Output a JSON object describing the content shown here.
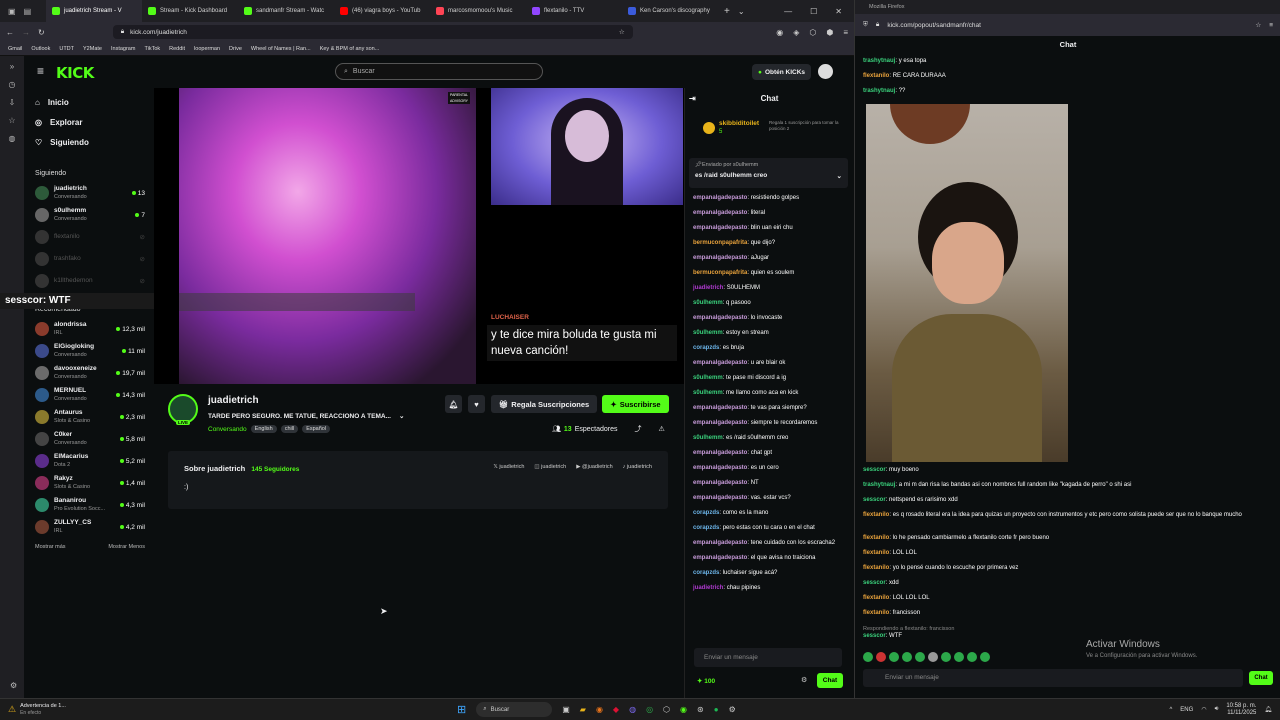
{
  "browser": {
    "tabs": [
      {
        "label": "juadietrich Stream - V",
        "color": "#53fc18",
        "active": true
      },
      {
        "label": "Stream - Kick Dashboard",
        "color": "#53fc18"
      },
      {
        "label": "sandmanfr Stream - Watc",
        "color": "#53fc18"
      },
      {
        "label": "(46) viagra boys - YouTub",
        "color": "#ff0000"
      },
      {
        "label": "marcosmomoou's Music",
        "color": "#ff4455"
      },
      {
        "label": "flextanilo - TTV",
        "color": "#9146ff"
      },
      {
        "label": "Ken Carson's discography",
        "color": "#3b5bdb"
      }
    ],
    "url": "kick.com/juadietrich",
    "bookmarks": [
      "Gmail",
      "Outlook",
      "UTDT",
      "Y2Mate",
      "Instagram",
      "TikTok",
      "Reddit",
      "looperman",
      "Drive",
      "Wheel of Names | Ran...",
      "Key & BPM of any son..."
    ]
  },
  "kick": {
    "search_placeholder": "Buscar",
    "kicks_label": "Obtén KICKs",
    "nav": [
      {
        "label": "Inicio",
        "icon": "home-icon"
      },
      {
        "label": "Explorar",
        "icon": "compass-icon"
      },
      {
        "label": "Siguiendo",
        "icon": "heart-icon"
      }
    ],
    "following_header": "Siguiendo",
    "following": [
      {
        "name": "juadietrich",
        "sub": "Conversando",
        "count": "13",
        "online": true
      },
      {
        "name": "s0ulhemm",
        "sub": "Conversando",
        "count": "7",
        "online": true
      },
      {
        "name": "flextanilo",
        "sub": "",
        "count": "",
        "online": false
      },
      {
        "name": "trashfako",
        "sub": "",
        "count": "",
        "online": false
      },
      {
        "name": "k1llthedemon",
        "sub": "",
        "count": "",
        "online": false
      }
    ],
    "overlay_user": "sesscor",
    "overlay_text": ": WTF",
    "recommended_header": "Recomendado",
    "recommended": [
      {
        "name": "alondrissa",
        "sub": "IRL",
        "count": "12,3 mil"
      },
      {
        "name": "ElGiogloking",
        "sub": "Conversando",
        "count": "11 mil"
      },
      {
        "name": "davooxeneize",
        "sub": "Conversando",
        "count": "19,7 mil"
      },
      {
        "name": "MERNUEL",
        "sub": "Conversando",
        "count": "14,3 mil"
      },
      {
        "name": "Antaurus",
        "sub": "Slots & Casino",
        "count": "2,3 mil"
      },
      {
        "name": "C0ker",
        "sub": "Conversando",
        "count": "5,8 mil"
      },
      {
        "name": "ElMacarius",
        "sub": "Dota 2",
        "count": "5,2 mil"
      },
      {
        "name": "Rakyz",
        "sub": "Slots & Casino",
        "count": "1,4 mil"
      },
      {
        "name": "Bananirou",
        "sub": "Pro Evolution Socc...",
        "count": "4,3 mil"
      },
      {
        "name": "ZULLYY_CS",
        "sub": "IRL",
        "count": "4,2 mil"
      }
    ],
    "show_more": "Mostrar más",
    "show_less": "Mostrar Menos",
    "caption_name": "LUCHAISER",
    "caption_text": "y te dice mira boluda te gusta mi nueva canción!",
    "streamer": "juadietrich",
    "title": "TARDE PERO SEGURO. ME TATUE, REACCIONO A TEMA...",
    "category": "Conversando",
    "tags": [
      "English",
      "chill",
      "Español"
    ],
    "gift_label": "Regala Suscripciones",
    "sub_label": "Suscribirse",
    "viewers_num": "13",
    "viewers_label": "Espectadores",
    "live_badge": "LIVE",
    "about_title": "Sobre juadietrich",
    "followers": "145 Seguidores",
    "about_text": ":)",
    "socials": [
      "juadietrich",
      "juadietrich",
      "@juadietrich",
      "juadietrich"
    ]
  },
  "chat": {
    "title": "Chat",
    "top_gifter": "skibbiditoilet",
    "top_gifter_count": "5",
    "gift_note": "Regala 1 suscripción para tomar la posición 2",
    "pinned_by": "Enviado por s0ulhemm",
    "pinned_text": "es /raid s0ulhemm creo",
    "messages": [
      {
        "u": "empanalgadepasto",
        "c": "#c79bd9",
        "t": "resistiendo golpes"
      },
      {
        "u": "empanalgadepasto",
        "c": "#c79bd9",
        "t": "literal"
      },
      {
        "u": "empanalgadepasto",
        "c": "#c79bd9",
        "t": "blin uan eiri chu"
      },
      {
        "u": "bermuconpapafrita",
        "c": "#e8a23c",
        "t": "que dijo?"
      },
      {
        "u": "empanalgadepasto",
        "c": "#c79bd9",
        "t": "aJugar"
      },
      {
        "u": "bermuconpapafrita",
        "c": "#e8a23c",
        "t": "quien es soulem"
      },
      {
        "u": "juadietrich",
        "c": "#b03ad1",
        "t": "S0ULHEMM"
      },
      {
        "u": "s0ulhemm",
        "c": "#3ad17c",
        "t": "q pasooo"
      },
      {
        "u": "empanalgadepasto",
        "c": "#c79bd9",
        "t": "lo invocaste"
      },
      {
        "u": "s0ulhemm",
        "c": "#3ad17c",
        "t": "estoy en stream"
      },
      {
        "u": "corapzds",
        "c": "#6cb4e8",
        "t": "es bruja"
      },
      {
        "u": "empanalgadepasto",
        "c": "#c79bd9",
        "t": "u are blair ok"
      },
      {
        "u": "s0ulhemm",
        "c": "#3ad17c",
        "t": "te pase mi discord a ig"
      },
      {
        "u": "s0ulhemm",
        "c": "#3ad17c",
        "t": "me llamo como aca en kick"
      },
      {
        "u": "empanalgadepasto",
        "c": "#c79bd9",
        "t": "te vas para siempre?"
      },
      {
        "u": "empanalgadepasto",
        "c": "#c79bd9",
        "t": "siempre te recordaremos"
      },
      {
        "u": "s0ulhemm",
        "c": "#3ad17c",
        "t": "es /raid s0ulhemm creo"
      },
      {
        "u": "empanalgadepasto",
        "c": "#c79bd9",
        "t": "chat gpt"
      },
      {
        "u": "empanalgadepasto",
        "c": "#c79bd9",
        "t": "es un cero"
      },
      {
        "u": "empanalgadepasto",
        "c": "#c79bd9",
        "t": "NT"
      },
      {
        "u": "empanalgadepasto",
        "c": "#c79bd9",
        "t": "vas. estar vcs?"
      },
      {
        "u": "corapzds",
        "c": "#6cb4e8",
        "t": "como es la mano"
      },
      {
        "u": "corapzds",
        "c": "#6cb4e8",
        "t": "pero estas con tu cara o en el chat"
      },
      {
        "u": "empanalgadepasto",
        "c": "#c79bd9",
        "t": "tene cuidado con los escracha2"
      },
      {
        "u": "empanalgadepasto",
        "c": "#c79bd9",
        "t": "el que avisa no traiciona"
      },
      {
        "u": "corapzds",
        "c": "#6cb4e8",
        "t": "luchaiser sigue acá?"
      },
      {
        "u": "juadietrich",
        "c": "#b03ad1",
        "t": "chau pipines"
      }
    ],
    "input_placeholder": "Enviar un mensaje",
    "points": "100",
    "send_label": "Chat"
  },
  "popout": {
    "window_title": "Mozilla Firefox",
    "url": "kick.com/popout/sandmanfr/chat",
    "title": "Chat",
    "messages": [
      {
        "u": "trashytnauj",
        "c": "#3ad17c",
        "t": "y esa topa"
      },
      {
        "u": "flextanilo",
        "c": "#e8a23c",
        "t": "RE CARA DURAAA"
      },
      {
        "u": "trashytnauj",
        "c": "#3ad17c",
        "t": "??"
      },
      {
        "u": "sesscor",
        "c": "#3ad17c",
        "t": "muy boeno"
      },
      {
        "u": "trashytnauj",
        "c": "#3ad17c",
        "t": "a mi m dan risa las bandas asi con nombres full random like \"kagada de perro\" o shi asi"
      },
      {
        "u": "sesscor",
        "c": "#3ad17c",
        "t": "nettspend es rarisimo xdd"
      },
      {
        "u": "flextanilo",
        "c": "#e8a23c",
        "t": "es q rosado literal era la idea para quizas un proyecto con instrumentos y etc pero como solista puede ser que no lo banque mucho"
      },
      {
        "u": "flextanilo",
        "c": "#e8a23c",
        "t": "lo he pensado cambiarmelo a flextanilo corte fr pero bueno"
      },
      {
        "u": "flextanilo",
        "c": "#e8a23c",
        "t": "LOL LOL"
      },
      {
        "u": "flextanilo",
        "c": "#e8a23c",
        "t": "yo lo pensé cuando lo escuche por primera vez"
      },
      {
        "u": "sesscor",
        "c": "#3ad17c",
        "t": "xdd"
      },
      {
        "u": "flextanilo",
        "c": "#e8a23c",
        "t": "LOL LOL LOL"
      },
      {
        "u": "flextanilo",
        "c": "#e8a23c",
        "t": "francisson"
      },
      {
        "u": "sesscor",
        "c": "#3ad17c",
        "t": "WTF"
      }
    ],
    "reply_note": "Respondiendo a flextanilo: francisson",
    "input_placeholder": "Enviar un mensaje",
    "send_label": "Chat",
    "activate_title": "Activar Windows",
    "activate_sub": "Ve a Configuración para activar Windows."
  },
  "taskbar": {
    "notif_title": "Advertencia de 1...",
    "notif_sub": "En efecto",
    "search": "Buscar",
    "lang": "ENG",
    "time": "10:58 p. m.",
    "date": "11/11/2025"
  }
}
